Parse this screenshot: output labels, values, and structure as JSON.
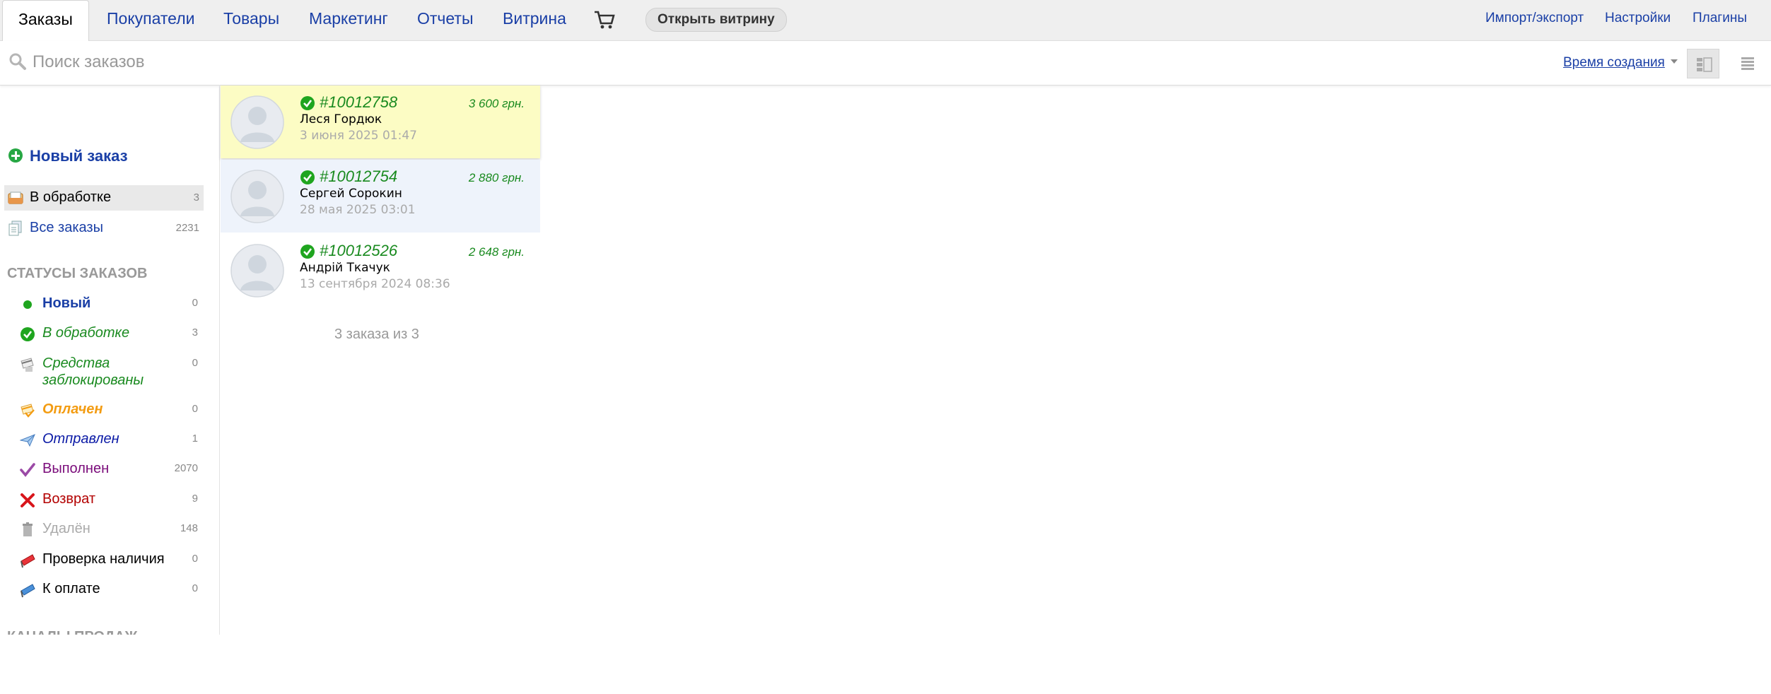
{
  "nav": {
    "tabs": [
      {
        "label": "Заказы",
        "active": true
      },
      {
        "label": "Покупатели"
      },
      {
        "label": "Товары"
      },
      {
        "label": "Маркетинг"
      },
      {
        "label": "Отчеты"
      },
      {
        "label": "Витрина"
      }
    ],
    "cart_icon": "cart-icon",
    "open_storefront": "Открыть витрину",
    "right_links": [
      "Импорт/экспорт",
      "Настройки",
      "Плагины"
    ]
  },
  "search": {
    "placeholder": "Поиск заказов",
    "value": "",
    "sort_label": "Время создания"
  },
  "sidebar": {
    "new_order": "Новый заказ",
    "filters": [
      {
        "label": "В обработке",
        "count": "3",
        "icon": "inbox-icon",
        "selected": true
      },
      {
        "label": "Все заказы",
        "count": "2231",
        "icon": "documents-icon"
      }
    ],
    "statuses_title": "СТАТУСЫ ЗАКАЗОВ",
    "statuses": [
      {
        "label": "Новый",
        "count": "0",
        "icon": "green-dot-icon",
        "color": "#1a3fa6",
        "italic": false,
        "bold": true
      },
      {
        "label": "В обработке",
        "count": "3",
        "icon": "green-check-icon",
        "color": "#198a1f",
        "italic": true
      },
      {
        "label": "Средства заблокированы",
        "count": "0",
        "icon": "card-lock-icon",
        "color": "#198a1f",
        "italic": true
      },
      {
        "label": "Оплачен",
        "count": "0",
        "icon": "paid-icon",
        "color": "#f39c12",
        "italic": true,
        "bold": true
      },
      {
        "label": "Отправлен",
        "count": "1",
        "icon": "paper-plane-icon",
        "color": "#0b1aa6",
        "italic": true
      },
      {
        "label": "Выполнен",
        "count": "2070",
        "icon": "purple-check-icon",
        "color": "#7a0b7a",
        "italic": false
      },
      {
        "label": "Возврат",
        "count": "9",
        "icon": "red-cross-icon",
        "color": "#b30000",
        "italic": false
      },
      {
        "label": "Удалён",
        "count": "148",
        "icon": "trash-icon",
        "color": "#aaaaaa",
        "italic": false
      },
      {
        "label": "Проверка наличия",
        "count": "0",
        "icon": "red-flag-icon",
        "color": "#000000",
        "italic": false
      },
      {
        "label": "К оплате",
        "count": "0",
        "icon": "blue-flag-icon",
        "color": "#000000",
        "italic": false
      }
    ],
    "channels_title": "КАНАЛЫ ПРОДАЖ"
  },
  "orders": [
    {
      "number": "#10012758",
      "price": "3 600 грн.",
      "customer": "Леся Гордюк",
      "date": "3 июня 2025 01:47",
      "selected": true
    },
    {
      "number": "#10012754",
      "price": "2 880 грн.",
      "customer": "Сергей Сорокин",
      "date": "28 мая 2025 03:01"
    },
    {
      "number": "#10012526",
      "price": "2 648 грн.",
      "customer": "Андрій Ткачук",
      "date": "13 сентября 2024 08:36"
    }
  ],
  "summary": "3 заказа из 3",
  "colors": {
    "link": "#1a3fa6",
    "accent_green": "#198a1f",
    "selected_order_bg": "#fcfcc4",
    "hover_order_bg": "#eef3fb"
  }
}
